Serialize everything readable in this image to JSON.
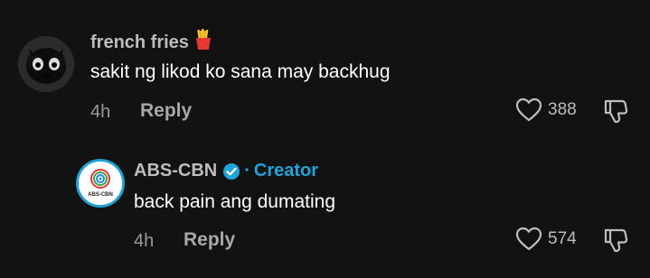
{
  "comments": [
    {
      "username": "french fries",
      "emoji": "🍟",
      "text": "sakit ng likod ko sana may backhug",
      "time": "4h",
      "reply_label": "Reply",
      "like_count": "388"
    },
    {
      "username": "ABS-CBN",
      "verified": true,
      "separator": "·",
      "badge": "Creator",
      "avatar_text": "ABS-CBN",
      "text": "back pain ang dumating",
      "time": "4h",
      "reply_label": "Reply",
      "like_count": "574"
    }
  ],
  "colors": {
    "background": "#121212",
    "creator_badge": "#20a4d9",
    "verified_badge": "#20a4d9"
  }
}
